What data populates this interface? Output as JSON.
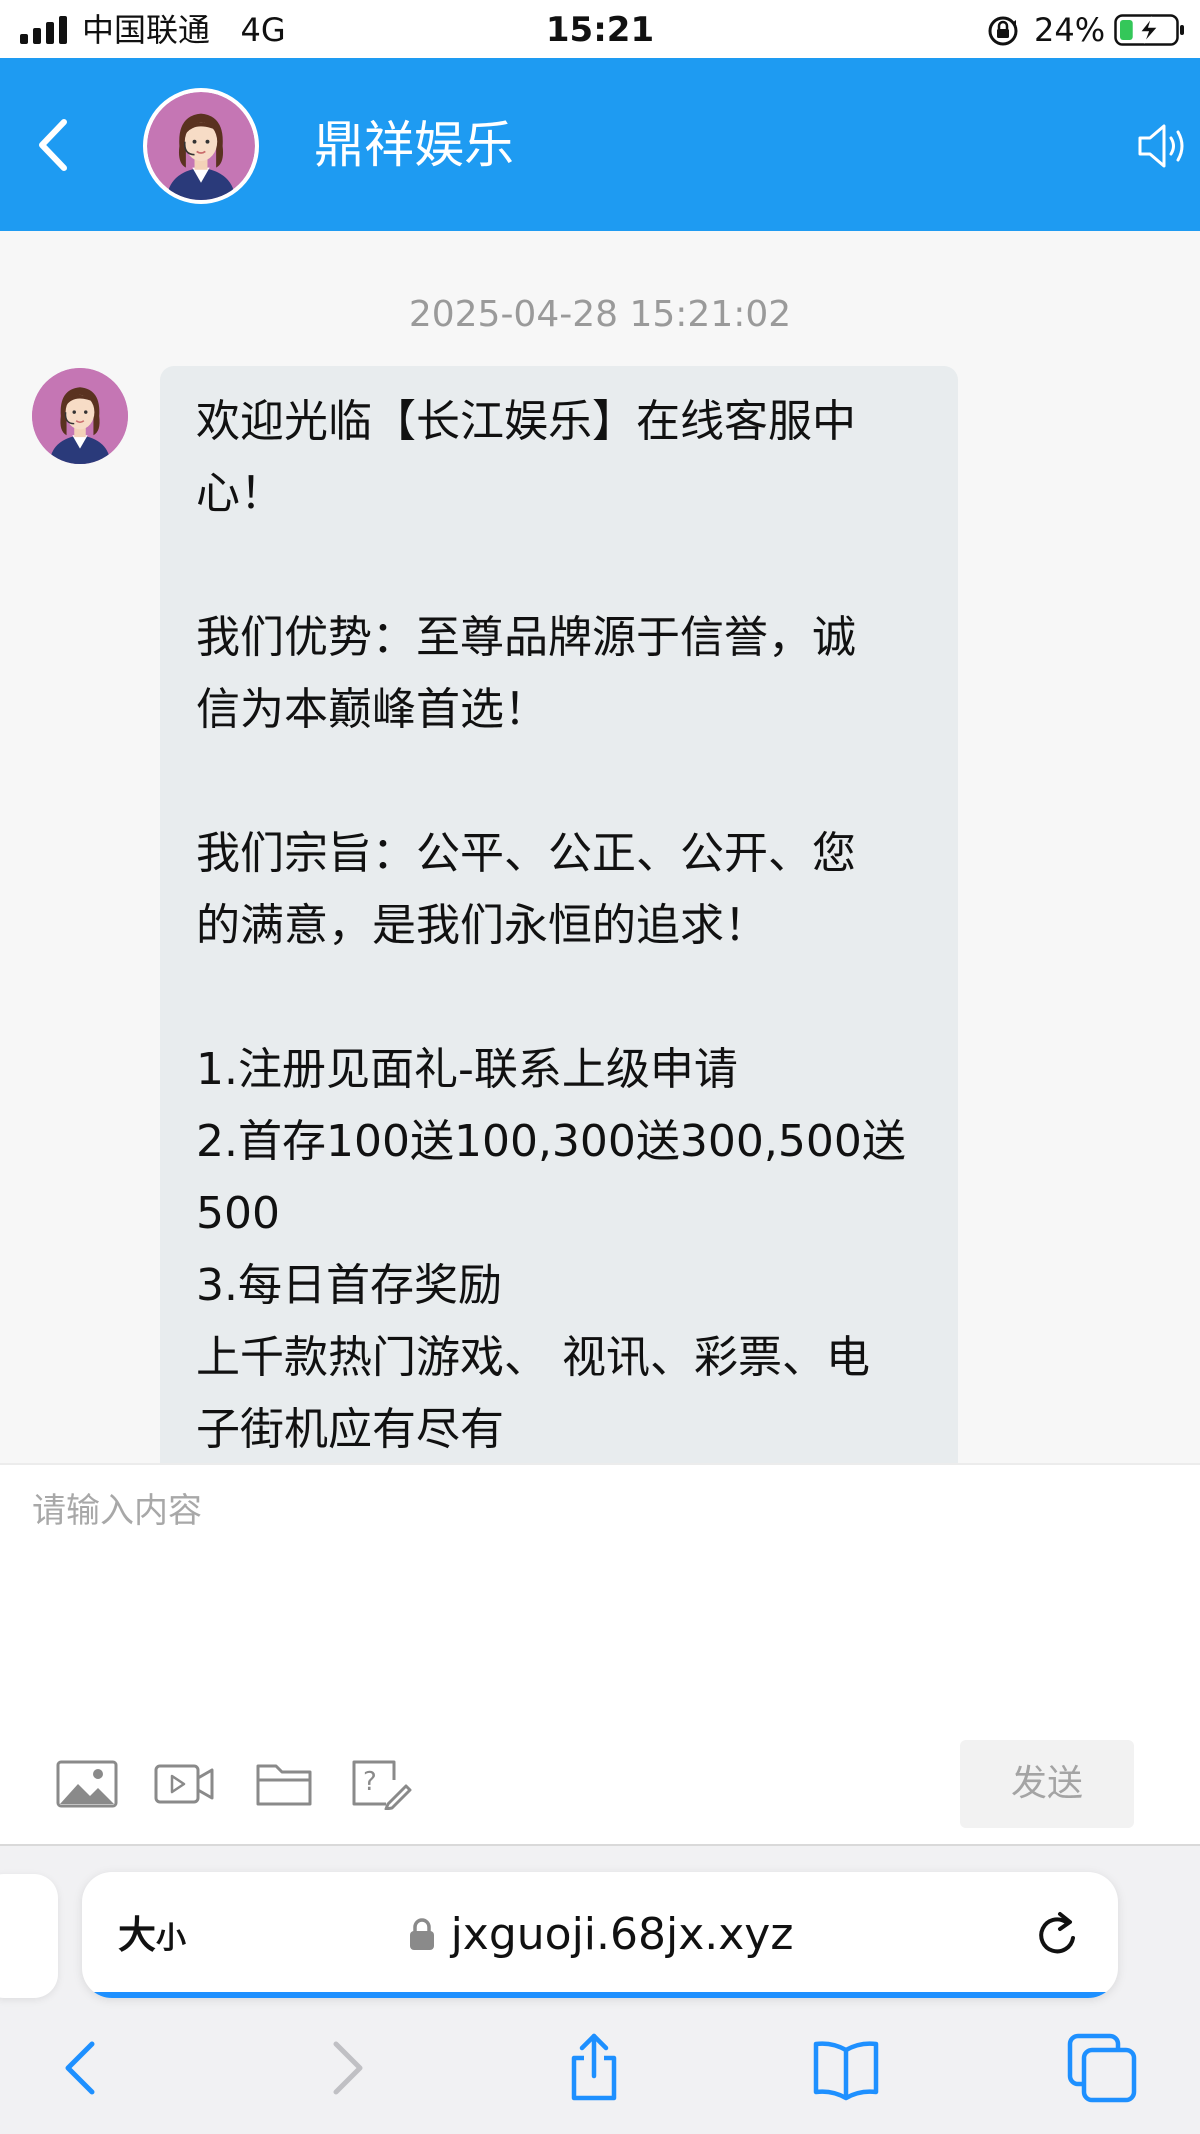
{
  "status_bar": {
    "carrier": "中国联通",
    "network": "4G",
    "time": "15:21",
    "battery_percent": "24%",
    "battery_level": 0.24
  },
  "header": {
    "title": "鼎祥娱乐",
    "accent_color": "#1e9bf2"
  },
  "chat": {
    "timestamp": "2025-04-28 15:21:02",
    "message_lines": [
      "欢迎光临【长江娱乐】在线客服中",
      "心！",
      "",
      "我们优势：至尊品牌源于信誉，诚",
      "信为本巅峰首选！",
      "",
      "我们宗旨：公平、公正、公开、您",
      "的满意，是我们永恒的追求！",
      "",
      "1.注册见面礼-联系上级申请",
      "2.首存100送100,300送300,500送",
      "500",
      "3.每日首存奖励",
      "上千款热门游戏、 视讯、彩票、电",
      "子街机应有尽有"
    ]
  },
  "composer": {
    "placeholder": "请输入内容",
    "value": "",
    "send_label": "发送",
    "tools": [
      "image-icon",
      "video-icon",
      "folder-icon",
      "help-edit-icon"
    ]
  },
  "browser": {
    "text_size_label_big": "大",
    "text_size_label_small": "小",
    "url": "jxguoji.68jx.xyz",
    "nav": [
      "back-icon",
      "forward-icon",
      "share-icon",
      "bookmarks-icon",
      "tabs-icon"
    ],
    "link_color": "#1e90ff"
  }
}
